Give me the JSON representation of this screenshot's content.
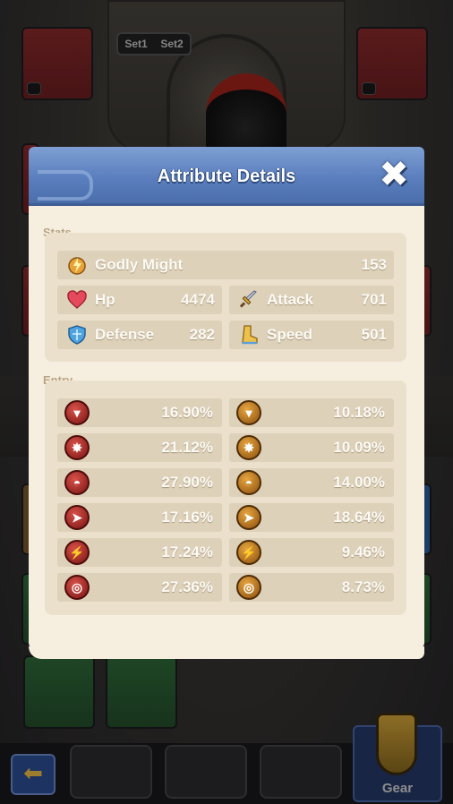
{
  "background": {
    "set_tabs": [
      "Set1",
      "Set2"
    ],
    "gear_label": "Gear"
  },
  "modal": {
    "title": "Attribute Details",
    "close_icon": "close-x-icon",
    "stats_title": "Stats",
    "godly_might": {
      "label": "Godly Might",
      "value": "153",
      "icon": "lightning-helmet-icon"
    },
    "stats": [
      {
        "label": "Hp",
        "value": "4474",
        "icon": "heart-icon"
      },
      {
        "label": "Attack",
        "value": "701",
        "icon": "sword-icon"
      },
      {
        "label": "Defense",
        "value": "282",
        "icon": "shield-icon"
      },
      {
        "label": "Speed",
        "value": "501",
        "icon": "boot-icon"
      }
    ],
    "entry_title": "Entry",
    "entries": [
      {
        "left": "16.90%",
        "right": "10.18%"
      },
      {
        "left": "21.12%",
        "right": "10.09%"
      },
      {
        "left": "27.90%",
        "right": "14.00%"
      },
      {
        "left": "17.16%",
        "right": "18.64%"
      },
      {
        "left": "17.24%",
        "right": "9.46%"
      },
      {
        "left": "27.36%",
        "right": "8.73%"
      }
    ]
  },
  "colors": {
    "header_blue": "#5b7fbe",
    "panel_cream": "#f6efe0",
    "row_tan": "#ddd1ba",
    "red_icon": "#b3302a",
    "gold_icon": "#c67c1d"
  }
}
